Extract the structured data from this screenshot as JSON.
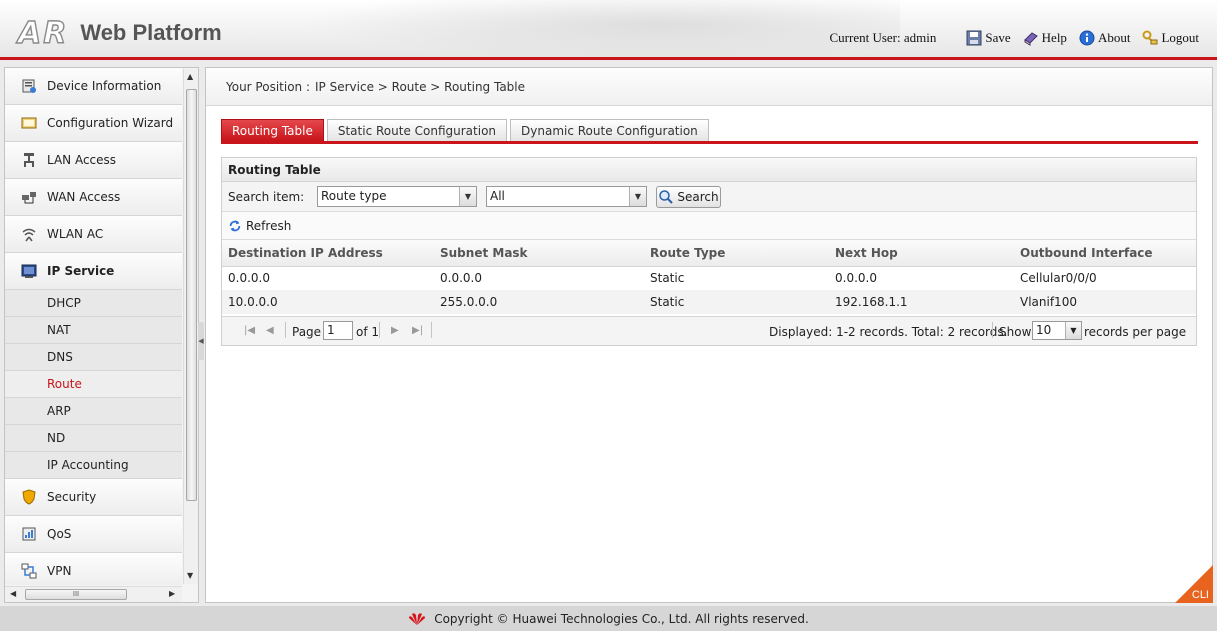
{
  "header": {
    "logo_mark": "AR",
    "title": "Web Platform",
    "current_user_label": "Current User: admin",
    "buttons": [
      {
        "name": "save",
        "label": "Save",
        "icon": "floppy-icon"
      },
      {
        "name": "help",
        "label": "Help",
        "icon": "book-icon"
      },
      {
        "name": "about",
        "label": "About",
        "icon": "info-icon"
      },
      {
        "name": "logout",
        "label": "Logout",
        "icon": "keys-icon"
      }
    ]
  },
  "sidebar": {
    "items_top": [
      {
        "label": "Device Information",
        "icon": "device-icon"
      },
      {
        "label": "Configuration Wizard",
        "icon": "wizard-icon"
      },
      {
        "label": "LAN Access",
        "icon": "lan-icon"
      },
      {
        "label": "WAN Access",
        "icon": "wan-icon"
      },
      {
        "label": "WLAN AC",
        "icon": "wlan-icon"
      },
      {
        "label": "IP Service",
        "icon": "ip-icon"
      }
    ],
    "sub_items": [
      "DHCP",
      "NAT",
      "DNS",
      "Route",
      "ARP",
      "ND",
      "IP Accounting"
    ],
    "selected_sub": "Route",
    "items_bottom": [
      {
        "label": "Security",
        "icon": "shield-icon"
      },
      {
        "label": "QoS",
        "icon": "qos-icon"
      },
      {
        "label": "VPN",
        "icon": "vpn-icon"
      }
    ],
    "hscroll_grip": "III"
  },
  "breadcrumb": {
    "prefix": "Your Position :",
    "path": "IP Service > Route > Routing Table"
  },
  "tabs": [
    "Routing Table",
    "Static Route Configuration",
    "Dynamic Route Configuration"
  ],
  "active_tab": "Routing Table",
  "panel": {
    "title": "Routing Table",
    "search_label": "Search item:",
    "search_field_value": "Route type",
    "search_value": "All",
    "search_button": "Search",
    "refresh_label": "Refresh",
    "columns": [
      "Destination IP Address",
      "Subnet Mask",
      "Route Type",
      "Next Hop",
      "Outbound Interface"
    ],
    "rows": [
      [
        "0.0.0.0",
        "0.0.0.0",
        "Static",
        "0.0.0.0",
        "Cellular0/0/0"
      ],
      [
        "10.0.0.0",
        "255.0.0.0",
        "Static",
        "192.168.1.1",
        "Vlanif100"
      ]
    ],
    "pager": {
      "page_label": "Page",
      "page_value": "1",
      "of_label": "of 1",
      "summary": "Displayed: 1-2 records. Total: 2 records.",
      "show_label": "Show",
      "per_page": "10",
      "per_page_label": "records per page"
    }
  },
  "cli_label": "CLI",
  "footer": {
    "copyright": "Copyright © Huawei Technologies Co., Ltd. All rights reserved."
  },
  "colors": {
    "accent": "#c8141a",
    "cli": "#e8641e"
  }
}
